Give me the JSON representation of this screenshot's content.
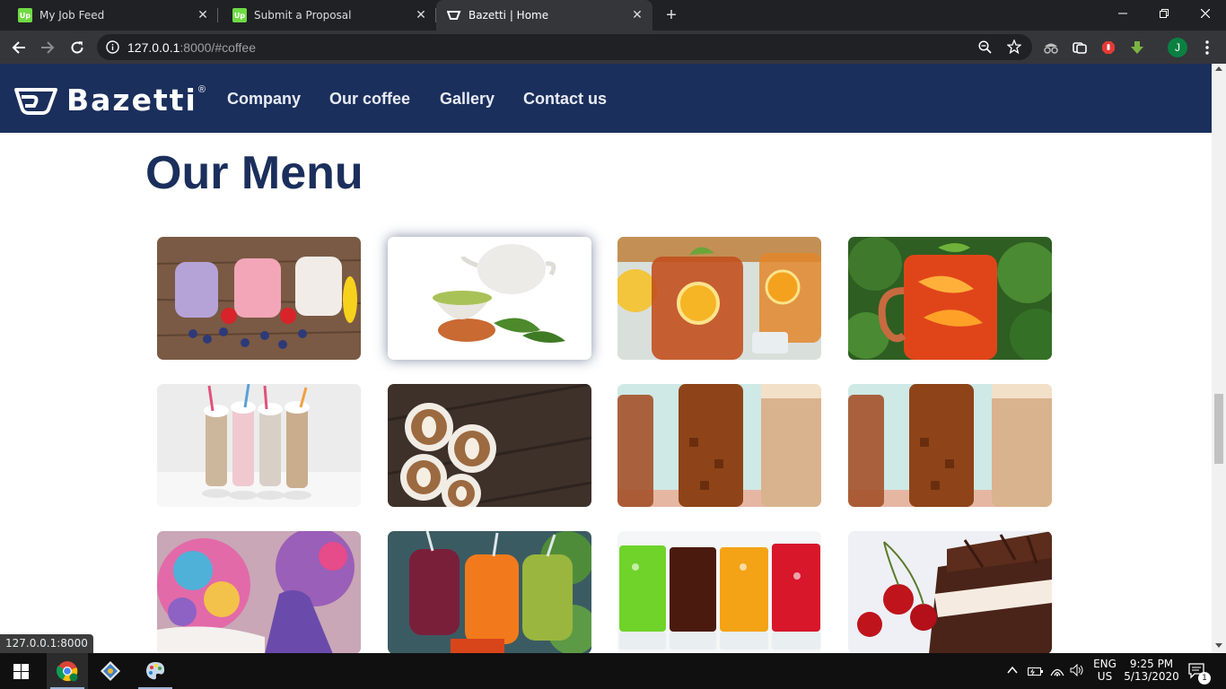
{
  "browser": {
    "tabs": [
      {
        "title": "My Job Feed",
        "favicon": "upwork-icon",
        "active": false
      },
      {
        "title": "Submit a Proposal",
        "favicon": "upwork-icon",
        "active": false
      },
      {
        "title": "Bazetti | Home",
        "favicon": "bazetti-icon",
        "active": true
      }
    ],
    "address": {
      "host": "127.0.0.1",
      "rest": ":8000/#coffee"
    },
    "profile_initial": "J",
    "status_url": "127.0.0.1:8000"
  },
  "site": {
    "brand": "Bazetti",
    "brand_mark": "®",
    "nav": [
      "Company",
      "Our coffee",
      "Gallery",
      "Contact us"
    ],
    "menu_title": "Our Menu"
  },
  "menu_items": [
    {
      "image": "berry smoothies"
    },
    {
      "image": "green tea with teapot"
    },
    {
      "image": "iced lemon tea jar"
    },
    {
      "image": "peach iced tea mug"
    },
    {
      "image": "milkshakes with straws"
    },
    {
      "image": "latte art cups"
    },
    {
      "image": "iced coffee glasses"
    },
    {
      "image": "iced coffee glasses"
    },
    {
      "image": "rainbow ice cream"
    },
    {
      "image": "fresh juices"
    },
    {
      "image": "colorful soda glasses"
    },
    {
      "image": "chocolate cherry cake"
    }
  ],
  "taskbar": {
    "language": "ENG",
    "region": "US",
    "time": "9:25 PM",
    "date": "5/13/2020",
    "notifications": "1"
  },
  "colors": {
    "navbar": "#1b2f5c",
    "heading": "#1b2f5c",
    "browser_dark": "#202124",
    "toolbar": "#35363a"
  }
}
